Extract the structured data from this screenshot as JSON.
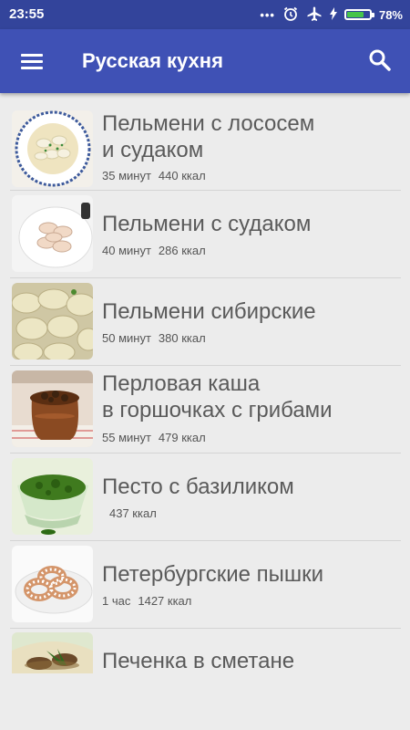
{
  "status_bar": {
    "time": "23:55",
    "battery_percent": "78%",
    "battery_level": 0.78,
    "icons": [
      "more-dots-icon",
      "alarm-clock-icon",
      "airplane-mode-icon",
      "charging-bolt-icon",
      "battery-icon"
    ]
  },
  "appbar": {
    "title": "Русская кухня",
    "menu_icon": "hamburger-menu-icon",
    "search_icon": "search-icon"
  },
  "recipes": [
    {
      "title_lines": [
        "Пельмени с лососем",
        "и судаком"
      ],
      "time": "35 минут",
      "kcal": "440 ккал",
      "image": "dumplings-soup-bowl"
    },
    {
      "title_lines": [
        "Пельмени с судаком"
      ],
      "time": "40 минут",
      "kcal": "286 ккал",
      "image": "dumplings-plate"
    },
    {
      "title_lines": [
        "Пельмени сибирские"
      ],
      "time": "50 минут",
      "kcal": "380 ккал",
      "image": "dumplings-closeup"
    },
    {
      "title_lines": [
        "Перловая каша",
        "в горшочках с грибами"
      ],
      "time": "55 минут",
      "kcal": "479 ккал",
      "image": "clay-pot-mushrooms"
    },
    {
      "title_lines": [
        "Песто с базиликом"
      ],
      "time": "",
      "kcal": "437 ккал",
      "image": "pesto-bowl"
    },
    {
      "title_lines": [
        "Петербургские пышки"
      ],
      "time": "1 час",
      "kcal": "1427 ккал",
      "image": "donuts-plate"
    },
    {
      "title_lines": [
        "Печенка в сметане"
      ],
      "time": "",
      "kcal": "",
      "image": "liver-dish"
    }
  ]
}
